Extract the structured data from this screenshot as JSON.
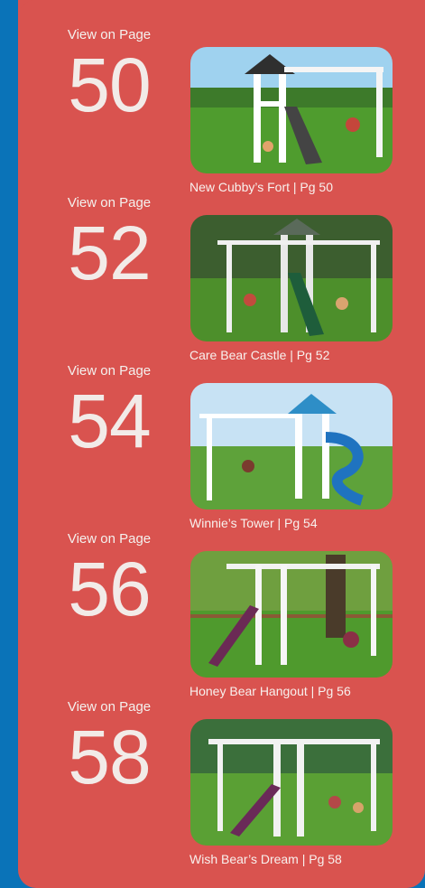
{
  "entries": [
    {
      "view_label": "View on Page",
      "page": "50",
      "caption": "New Cubby’s Fort | Pg 50",
      "roof": "#2f2f2f",
      "slide": "#444444",
      "sky": "#9fd2ef"
    },
    {
      "view_label": "View on Page",
      "page": "52",
      "caption": "Care Bear Castle | Pg 52",
      "roof": "#5a6a5a",
      "slide": "#1e5d3b",
      "sky": "#3c5e2f"
    },
    {
      "view_label": "View on Page",
      "page": "54",
      "caption": "Winnie’s Tower | Pg 54",
      "roof": "#2e8ec7",
      "slide": "#1f73c0",
      "sky": "#c7e2f4"
    },
    {
      "view_label": "View on Page",
      "page": "56",
      "caption": "Honey Bear Hangout | Pg 56",
      "roof": "#f2f2f2",
      "slide": "#6b2a55",
      "sky": "#6f9f3f"
    },
    {
      "view_label": "View on Page",
      "page": "58",
      "caption": "Wish Bear’s Dream | Pg 58",
      "roof": "#f2f2f2",
      "slide": "#6a2a58",
      "sky": "#3b6f3b"
    }
  ]
}
